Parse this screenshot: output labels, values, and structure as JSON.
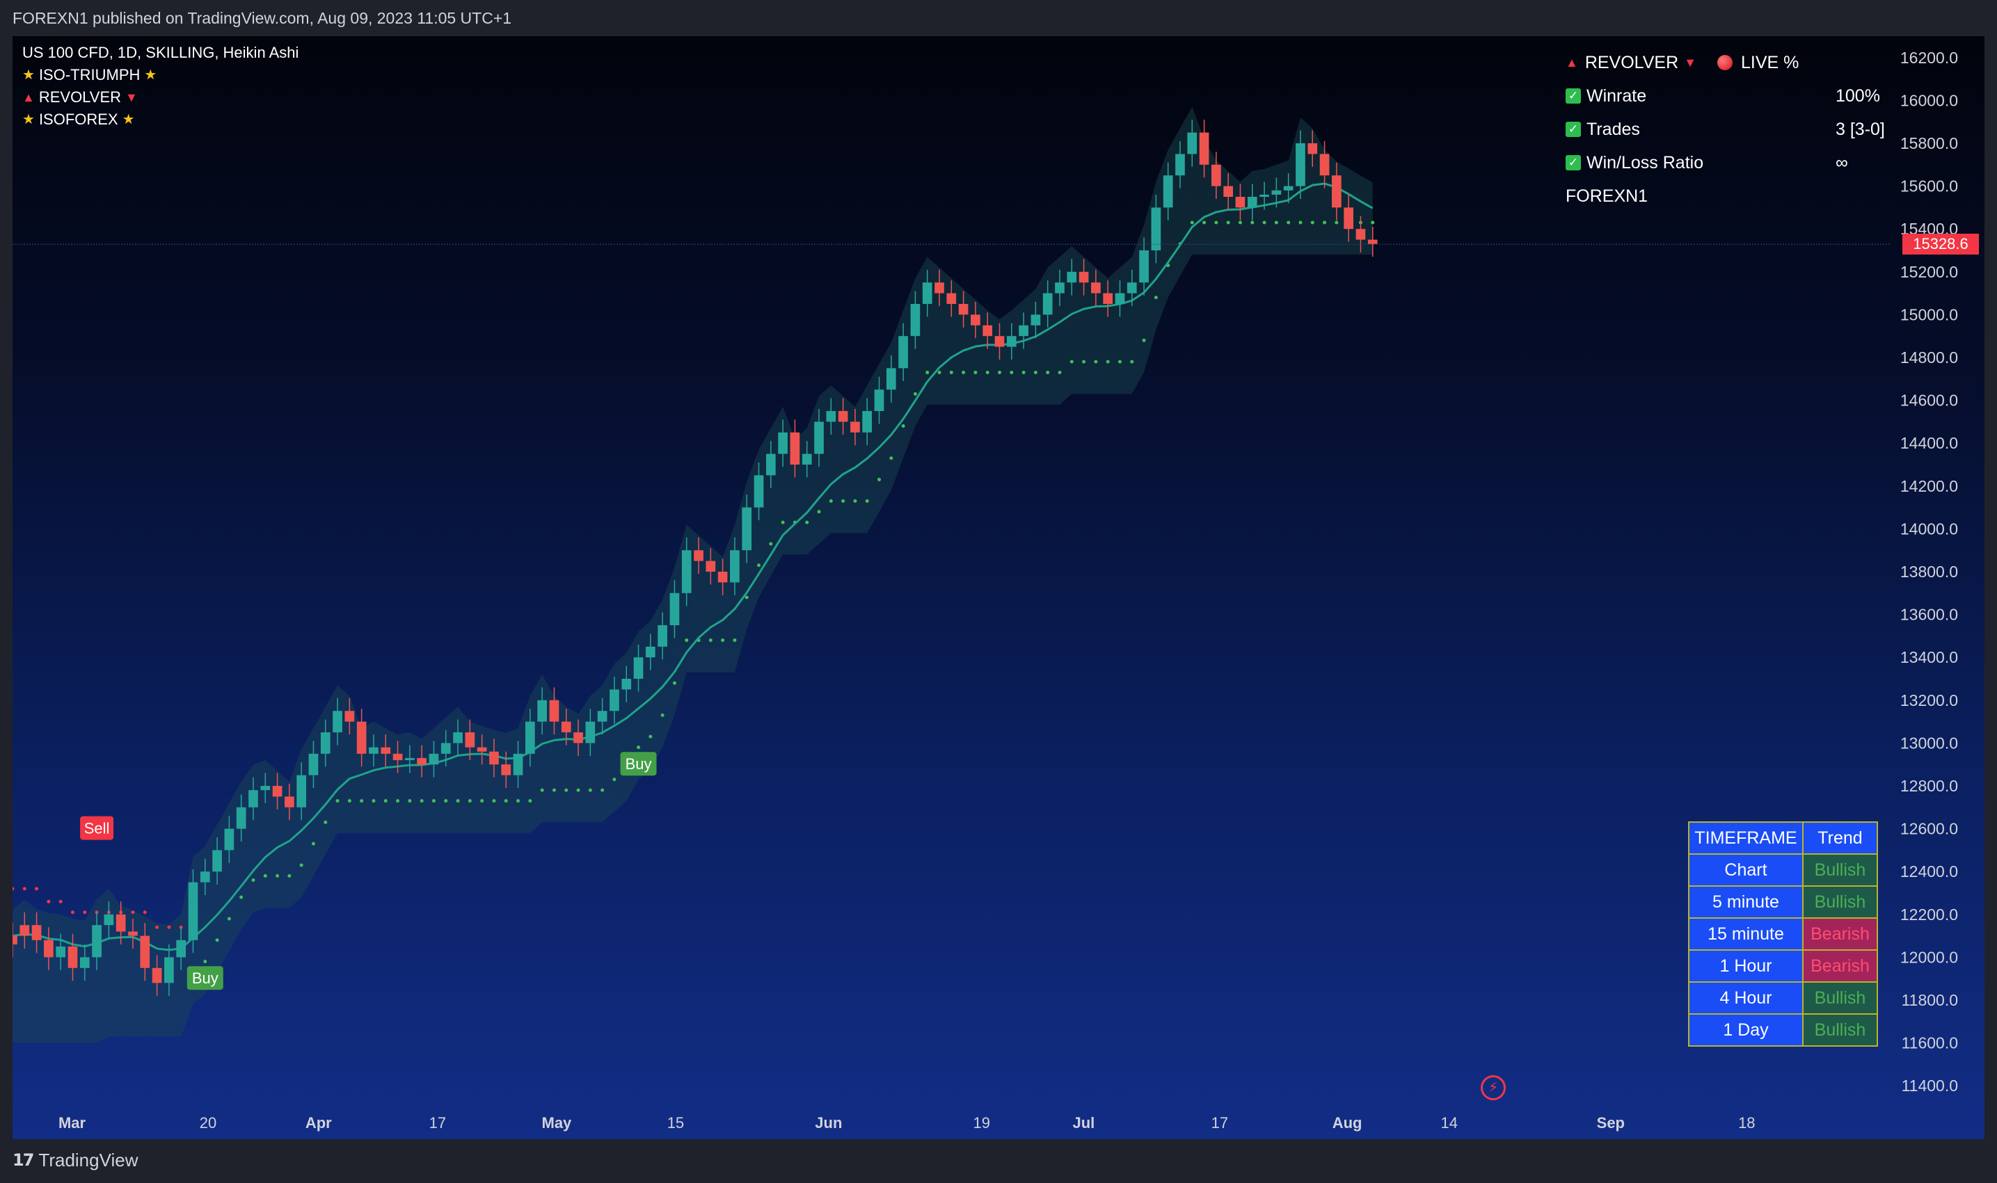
{
  "header": {
    "published": "FOREXN1 published on TradingView.com, Aug 09, 2023 11:05 UTC+1"
  },
  "legend": {
    "symbol": "US 100 CFD, 1D, SKILLING, Heikin Ashi",
    "indicators": [
      "ISO-TRIUMPH",
      "REVOLVER",
      "ISOFOREX"
    ]
  },
  "stats_panel": {
    "title": "REVOLVER",
    "live_label": "LIVE %",
    "rows": [
      {
        "label": "Winrate",
        "value": "100%"
      },
      {
        "label": "Trades",
        "value": "3 [3-0]"
      },
      {
        "label": "Win/Loss Ratio",
        "value": "∞"
      }
    ],
    "author": "FOREXN1"
  },
  "trend_table": {
    "headers": [
      "TIMEFRAME",
      "Trend"
    ],
    "rows": [
      {
        "tf": "Chart",
        "trend": "Bullish"
      },
      {
        "tf": "5 minute",
        "trend": "Bullish"
      },
      {
        "tf": "15 minute",
        "trend": "Bearish"
      },
      {
        "tf": "1 Hour",
        "trend": "Bearish"
      },
      {
        "tf": "4 Hour",
        "trend": "Bullish"
      },
      {
        "tf": "1 Day",
        "trend": "Bullish"
      }
    ]
  },
  "footer": {
    "brand": "TradingView"
  },
  "colors": {
    "bull": "#26a69a",
    "bear": "#ef5350",
    "ema": "#1fa38a",
    "ema_bear": "#e0413a",
    "dots_bull": "#43c05a",
    "dots_bear": "#f23645",
    "band": "#1b4a52"
  },
  "chart_data": {
    "type": "candlestick",
    "last_price": "15328.6",
    "ylim": [
      11300,
      16300
    ],
    "y_ticks": [
      16200,
      16000,
      15800,
      15600,
      15400,
      15200,
      15000,
      14800,
      14600,
      14400,
      14200,
      14000,
      13800,
      13600,
      13400,
      13200,
      13000,
      12800,
      12600,
      12400,
      12200,
      12000,
      11800,
      11600,
      11400
    ],
    "x_ticks": [
      {
        "label": "Mar",
        "day": 4
      },
      {
        "label": "20",
        "day": 20
      },
      {
        "label": "Apr",
        "day": 33
      },
      {
        "label": "17",
        "day": 47
      },
      {
        "label": "May",
        "day": 61
      },
      {
        "label": "15",
        "day": 75
      },
      {
        "label": "Jun",
        "day": 93
      },
      {
        "label": "19",
        "day": 111
      },
      {
        "label": "Jul",
        "day": 123
      },
      {
        "label": "17",
        "day": 139
      },
      {
        "label": "Aug",
        "day": 154
      },
      {
        "label": "14",
        "day": 166
      },
      {
        "label": "Sep",
        "day": 185
      },
      {
        "label": "18",
        "day": 201
      }
    ],
    "x_range_days": [
      -3,
      218
    ],
    "candles_close": [
      12100,
      12150,
      12080,
      12000,
      12050,
      11950,
      12000,
      12150,
      12200,
      12120,
      12100,
      11950,
      11880,
      12000,
      12080,
      12350,
      12400,
      12500,
      12600,
      12700,
      12780,
      12800,
      12750,
      12700,
      12850,
      12950,
      13050,
      13150,
      13100,
      12950,
      12980,
      12950,
      12920,
      12930,
      12900,
      12950,
      13000,
      13050,
      12980,
      12960,
      12900,
      12850,
      12950,
      13100,
      13200,
      13100,
      13050,
      13000,
      13100,
      13150,
      13250,
      13300,
      13400,
      13450,
      13550,
      13700,
      13900,
      13850,
      13800,
      13750,
      13900,
      14100,
      14250,
      14350,
      14450,
      14300,
      14350,
      14500,
      14550,
      14500,
      14450,
      14550,
      14650,
      14750,
      14900,
      15050,
      15150,
      15100,
      15050,
      15000,
      14950,
      14900,
      14850,
      14900,
      14950,
      15000,
      15100,
      15150,
      15200,
      15150,
      15100,
      15050,
      15100,
      15150,
      15300,
      15500,
      15650,
      15750,
      15850,
      15700,
      15600,
      15550,
      15500,
      15550,
      15560,
      15580,
      15600,
      15800,
      15750,
      15650,
      15500,
      15400,
      15350,
      15330
    ],
    "candles_color": [
      "bear",
      "bear",
      "bear",
      "bear",
      "bull",
      "bear",
      "bull",
      "bull",
      "bull",
      "bear",
      "bear",
      "bear",
      "bear",
      "bull",
      "bull",
      "bull",
      "bull",
      "bull",
      "bull",
      "bull",
      "bull",
      "bull",
      "bear",
      "bear",
      "bull",
      "bull",
      "bull",
      "bull",
      "bear",
      "bear",
      "bull",
      "bear",
      "bear",
      "bull",
      "bear",
      "bull",
      "bull",
      "bull",
      "bear",
      "bear",
      "bear",
      "bear",
      "bull",
      "bull",
      "bull",
      "bear",
      "bear",
      "bear",
      "bull",
      "bull",
      "bull",
      "bull",
      "bull",
      "bull",
      "bull",
      "bull",
      "bull",
      "bear",
      "bear",
      "bear",
      "bull",
      "bull",
      "bull",
      "bull",
      "bull",
      "bear",
      "bull",
      "bull",
      "bull",
      "bear",
      "bear",
      "bull",
      "bull",
      "bull",
      "bull",
      "bull",
      "bull",
      "bear",
      "bear",
      "bear",
      "bear",
      "bear",
      "bear",
      "bull",
      "bull",
      "bull",
      "bull",
      "bull",
      "bull",
      "bear",
      "bear",
      "bear",
      "bull",
      "bull",
      "bull",
      "bull",
      "bull",
      "bull",
      "bull",
      "bear",
      "bear",
      "bear",
      "bear",
      "bull",
      "bull",
      "bull",
      "bull",
      "bull",
      "bear",
      "bear",
      "bear",
      "bear",
      "bear",
      "bear"
    ],
    "signals": [
      {
        "type": "Sell",
        "day": 7
      },
      {
        "type": "Buy",
        "day": 19
      },
      {
        "type": "Buy",
        "day": 71
      }
    ]
  }
}
